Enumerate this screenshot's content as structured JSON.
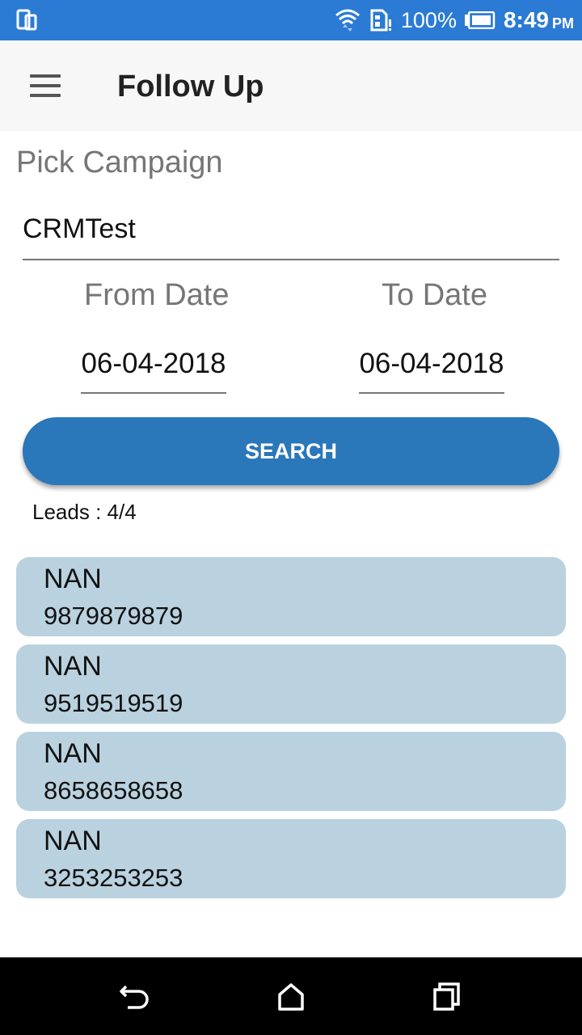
{
  "status_bar": {
    "battery_percent": "100%",
    "time": "8:49",
    "ampm": "PM",
    "icons": [
      "device-icon",
      "wifi-icon",
      "sim-icon",
      "battery-icon"
    ]
  },
  "app_bar": {
    "title": "Follow Up",
    "menu_icon": "hamburger-menu-icon"
  },
  "form": {
    "pick_campaign_label": "Pick Campaign",
    "campaign_value": "CRMTest",
    "from_date_label": "From Date",
    "to_date_label": "To Date",
    "from_date_value": "06-04-2018",
    "to_date_value": "06-04-2018",
    "search_label": "SEARCH"
  },
  "results": {
    "leads_count": "Leads : 4/4",
    "leads": [
      {
        "name": "NAN",
        "phone": "9879879879"
      },
      {
        "name": "NAN",
        "phone": "9519519519"
      },
      {
        "name": "NAN",
        "phone": "8658658658"
      },
      {
        "name": "NAN",
        "phone": "3253253253"
      }
    ]
  },
  "nav_bar": {
    "icons": [
      "back-icon",
      "home-icon",
      "recent-apps-icon"
    ]
  },
  "colors": {
    "status_bar": "#2b7bd4",
    "accent_button": "#2a77b9",
    "lead_card": "#bad2df"
  }
}
